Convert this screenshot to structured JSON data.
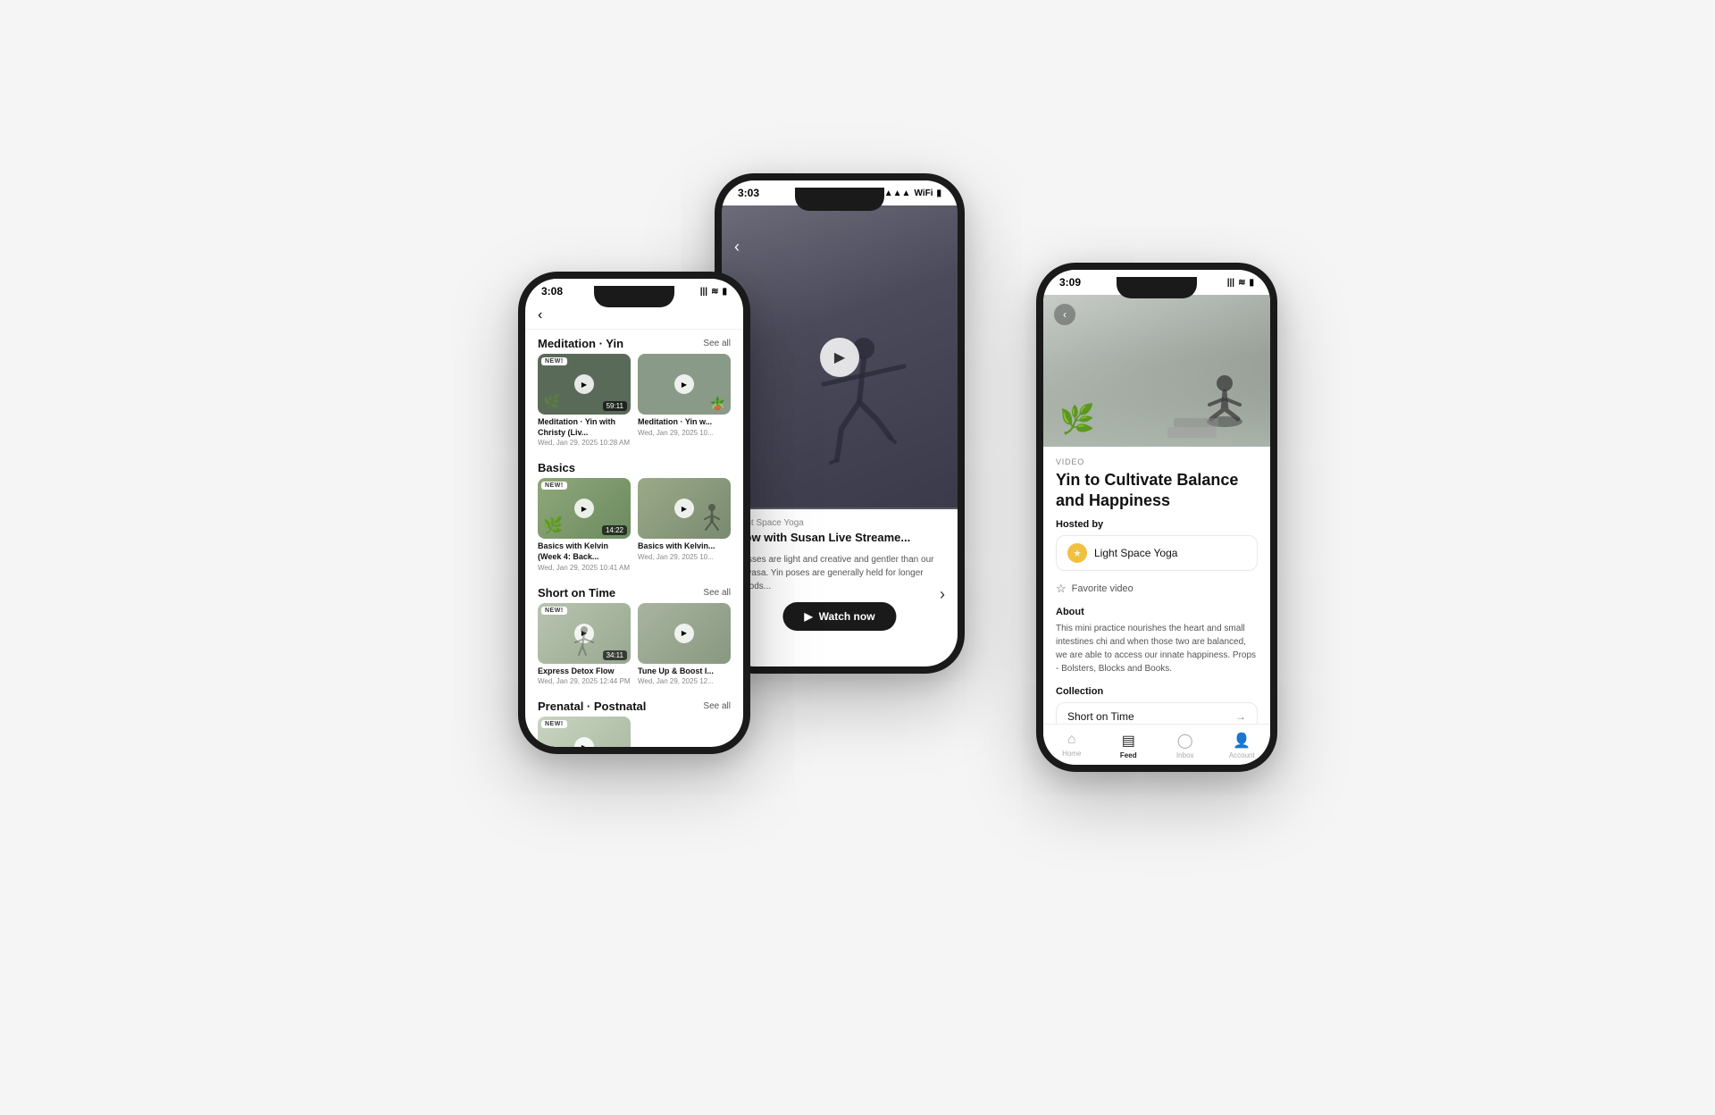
{
  "phones": {
    "back": {
      "time": "3:03",
      "title": "Flow with Susan Live Streame...",
      "channel": "Light Space Yoga",
      "description": "Classes are light and creative and gentler than our Vinyasa. Yin poses are generally held for longer periods...",
      "watch_now_label": "Watch now"
    },
    "left": {
      "time": "3:08",
      "sections": [
        {
          "name": "Meditation · Yin",
          "see_all": "See all",
          "videos": [
            {
              "title": "Meditation · Yin with Christy (Liv...",
              "date": "Wed, Jan 29, 2025 10:28 AM",
              "duration": "59:11",
              "is_new": true,
              "bg": "dark"
            },
            {
              "title": "Meditation · Yin w...",
              "date": "Wed, Jan 29, 2025 10...",
              "duration": "",
              "is_new": false,
              "bg": "medium"
            }
          ]
        },
        {
          "name": "Basics",
          "see_all": "",
          "videos": [
            {
              "title": "Basics with Kelvin (Week 4: Back...",
              "date": "Wed, Jan 29, 2025 10:41 AM",
              "duration": "14:22",
              "is_new": true,
              "bg": "light"
            },
            {
              "title": "Basics with Kelvin...",
              "date": "Wed, Jan 29, 2025 10...",
              "duration": "",
              "is_new": false,
              "bg": "medium"
            }
          ]
        },
        {
          "name": "Short on Time",
          "see_all": "See all",
          "videos": [
            {
              "title": "Express Detox Flow",
              "date": "Wed, Jan 29, 2025 12:44 PM",
              "duration": "34:11",
              "is_new": true,
              "bg": "light"
            },
            {
              "title": "Tune Up & Boost I...",
              "date": "Wed, Jan 29, 2025 12...",
              "duration": "",
              "is_new": false,
              "bg": "medium"
            }
          ]
        },
        {
          "name": "Prenatal · Postnatal",
          "see_all": "See all",
          "videos": []
        }
      ]
    },
    "right": {
      "time": "3:09",
      "label": "VIDEO",
      "title": "Yin to Cultivate Balance and Happiness",
      "hosted_by": "Hosted by",
      "host_name": "Light Space Yoga",
      "about_label": "About",
      "about_text": "This mini practice nourishes the heart and small intestines chi and when those two are balanced, we are able to access our innate happiness. Props - Bolsters, Blocks and Books.",
      "collection_label": "Collection",
      "collection_name": "Short on Time",
      "favorite_label": "Favorite video",
      "nav": [
        {
          "label": "Home",
          "icon": "🏠",
          "active": false
        },
        {
          "label": "Feed",
          "icon": "📋",
          "active": true
        },
        {
          "label": "Inbox",
          "icon": "💬",
          "active": false
        },
        {
          "label": "Account",
          "icon": "👤",
          "active": false
        }
      ]
    }
  }
}
